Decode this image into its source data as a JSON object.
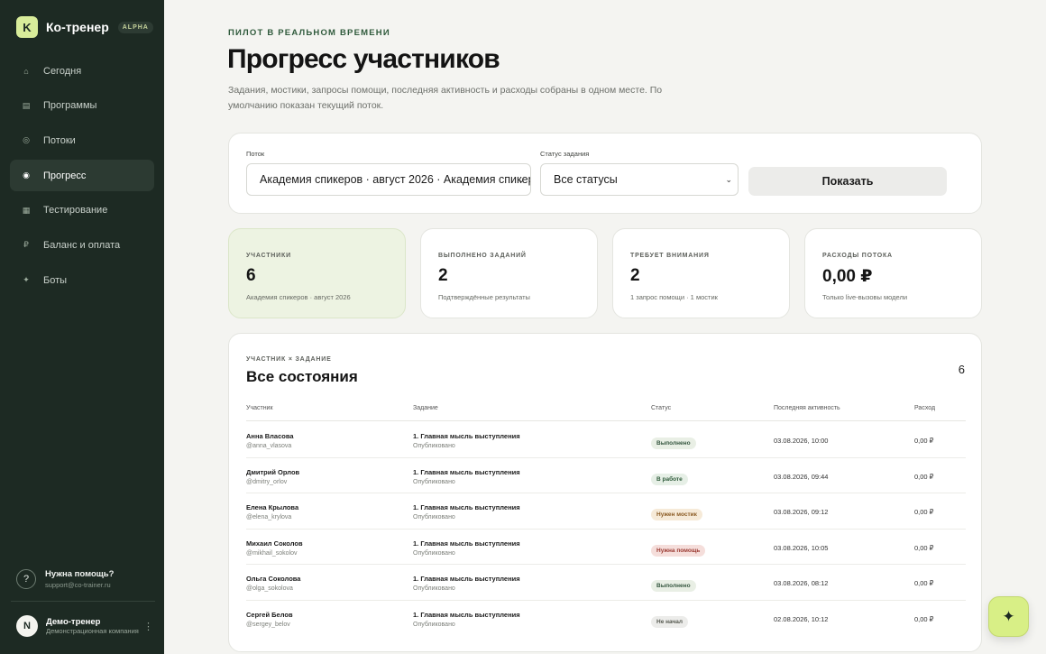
{
  "brand": {
    "logo_letter": "K",
    "name": "Ко-тренер",
    "badge": "ALPHA"
  },
  "nav": [
    {
      "icon": "⌂",
      "label": "Сегодня"
    },
    {
      "icon": "▤",
      "label": "Программы"
    },
    {
      "icon": "◎",
      "label": "Потоки"
    },
    {
      "icon": "◉",
      "label": "Прогресс",
      "active": true
    },
    {
      "icon": "▦",
      "label": "Тестирование"
    },
    {
      "icon": "₽",
      "label": "Баланс и оплата"
    },
    {
      "icon": "✦",
      "label": "Боты"
    }
  ],
  "help": {
    "icon": "?",
    "title": "Нужна помощь?",
    "email": "support@co-trainer.ru"
  },
  "user": {
    "avatar": "N",
    "name": "Демо-тренер",
    "subtitle": "Демонстрационная компания",
    "menu": "⋮"
  },
  "header": {
    "eyebrow": "ПИЛОТ В РЕАЛЬНОМ ВРЕМЕНИ",
    "title": "Прогресс участников",
    "subtitle": "Задания, мостики, запросы помощи, последняя активность и расходы собраны в одном месте. По умолчанию показан текущий поток."
  },
  "filters": {
    "stream_label": "Поток",
    "stream_value": "Академия спикеров · август 2026 · Академия спикеров",
    "status_label": "Статус задания",
    "status_value": "Все статусы",
    "show_button": "Показать"
  },
  "stats": [
    {
      "label": "УЧАСТНИКИ",
      "value": "6",
      "note": "Академия спикеров · август 2026"
    },
    {
      "label": "ВЫПОЛНЕНО ЗАДАНИЙ",
      "value": "2",
      "note": "Подтверждённые результаты"
    },
    {
      "label": "ТРЕБУЕТ ВНИМАНИЯ",
      "value": "2",
      "note": "1 запрос помощи · 1 мостик"
    },
    {
      "label": "РАСХОДЫ ПОТОКА",
      "value": "0,00 ₽",
      "note": "Только live-вызовы модели"
    }
  ],
  "table": {
    "eyebrow": "УЧАСТНИК × ЗАДАНИЕ",
    "title": "Все состояния",
    "count": "6",
    "headers": {
      "participant": "Участник",
      "task": "Задание",
      "status": "Статус",
      "activity": "Последняя активность",
      "cost": "Расход"
    },
    "rows": [
      {
        "name": "Анна Власова",
        "handle": "@anna_vlasova",
        "task": "1. Главная мысль выступления",
        "task_state": "Опубликовано",
        "status": "Выполнено",
        "status_kind": "done",
        "activity": "03.08.2026, 10:00",
        "cost": "0,00 ₽"
      },
      {
        "name": "Дмитрий Орлов",
        "handle": "@dmitry_orlov",
        "task": "1. Главная мысль выступления",
        "task_state": "Опубликовано",
        "status": "В работе",
        "status_kind": "work",
        "activity": "03.08.2026, 09:44",
        "cost": "0,00 ₽"
      },
      {
        "name": "Елена Крылова",
        "handle": "@elena_krylova",
        "task": "1. Главная мысль выступления",
        "task_state": "Опубликовано",
        "status": "Нужен мостик",
        "status_kind": "bridge",
        "activity": "03.08.2026, 09:12",
        "cost": "0,00 ₽"
      },
      {
        "name": "Михаил Соколов",
        "handle": "@mikhail_sokolov",
        "task": "1. Главная мысль выступления",
        "task_state": "Опубликовано",
        "status": "Нужна помощь",
        "status_kind": "help",
        "activity": "03.08.2026, 10:05",
        "cost": "0,00 ₽"
      },
      {
        "name": "Ольга Соколова",
        "handle": "@olga_sokolova",
        "task": "1. Главная мысль выступления",
        "task_state": "Опубликовано",
        "status": "Выполнено",
        "status_kind": "done",
        "activity": "03.08.2026, 08:12",
        "cost": "0,00 ₽"
      },
      {
        "name": "Сергей Белов",
        "handle": "@sergey_belov",
        "task": "1. Главная мысль выступления",
        "task_state": "Опубликовано",
        "status": "Не начал",
        "status_kind": "none",
        "activity": "02.08.2026, 10:12",
        "cost": "0,00 ₽"
      }
    ]
  },
  "fab": {
    "icon": "✦"
  }
}
